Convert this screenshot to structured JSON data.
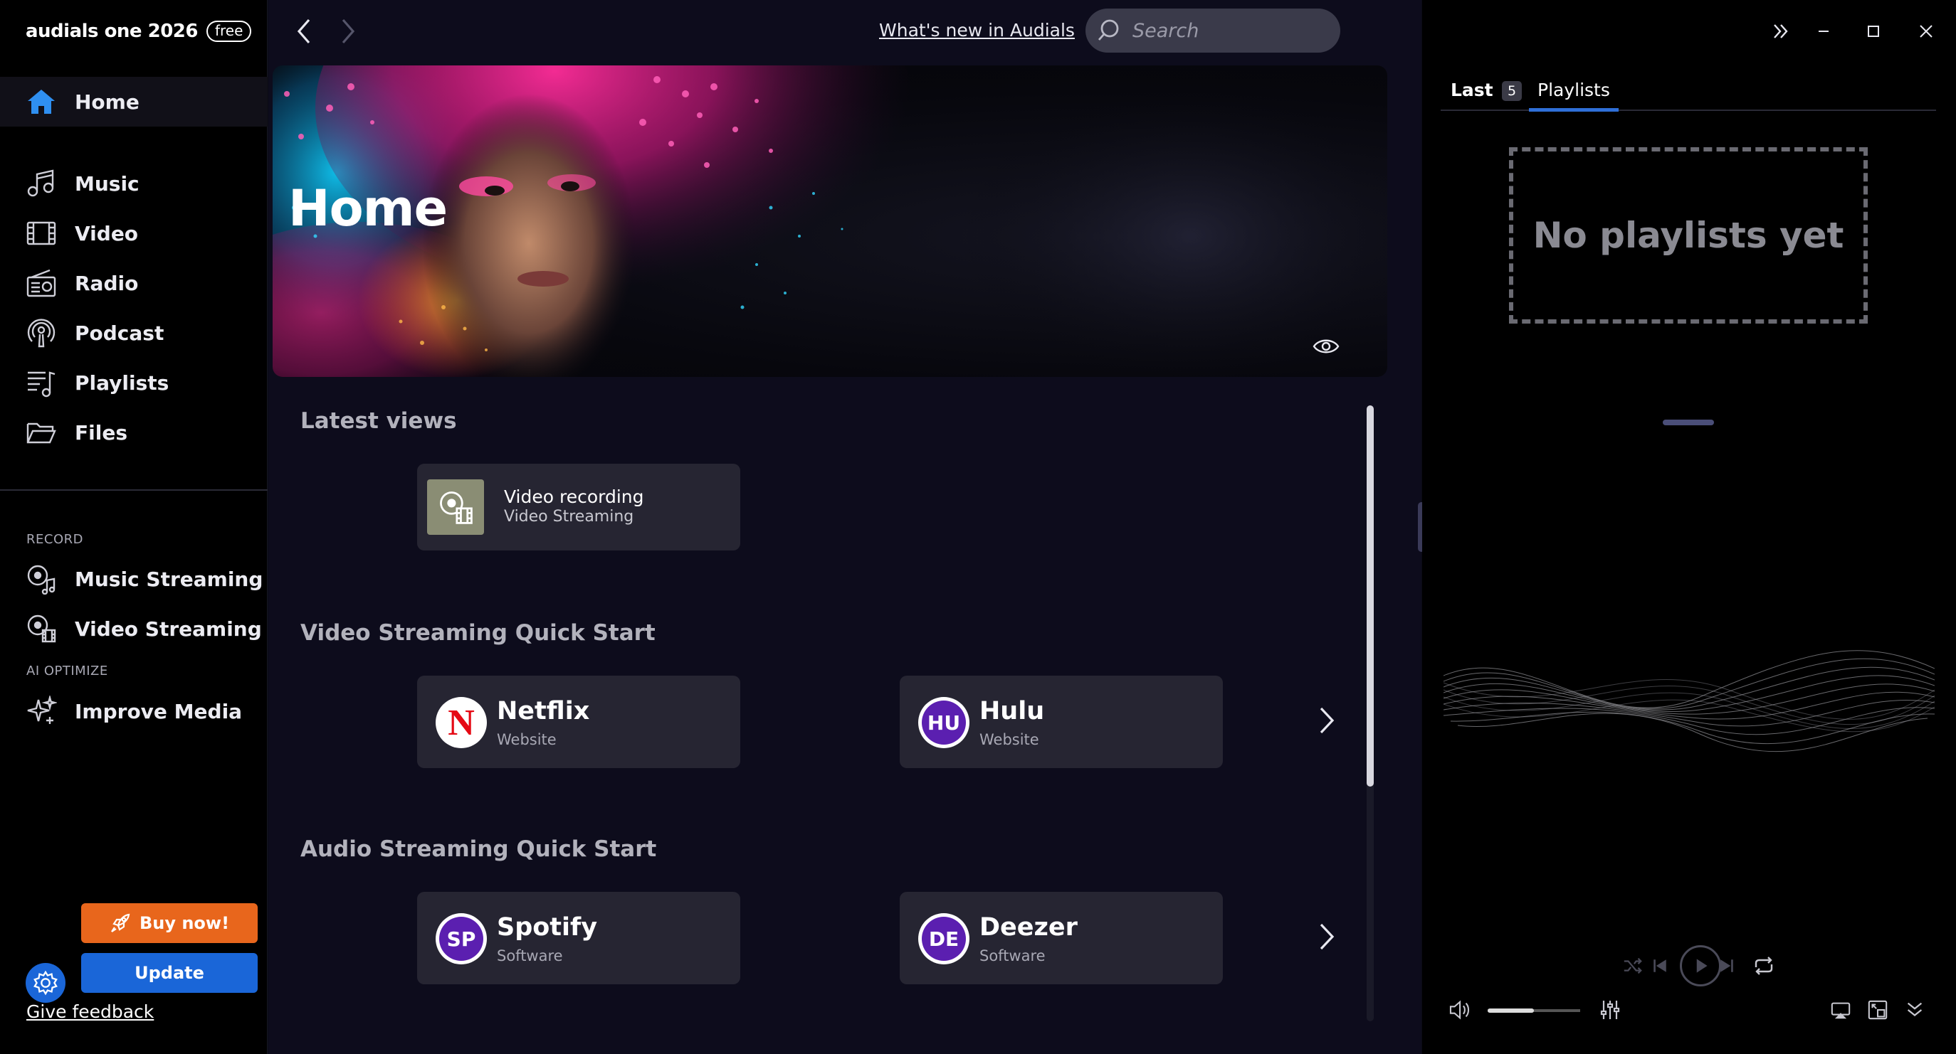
{
  "app": {
    "name": "audials one 2026",
    "badge": "free"
  },
  "sidebar": {
    "home": "Home",
    "items": [
      {
        "label": "Music",
        "icon": "music-note-icon"
      },
      {
        "label": "Video",
        "icon": "film-icon"
      },
      {
        "label": "Radio",
        "icon": "radio-icon"
      },
      {
        "label": "Podcast",
        "icon": "podcast-icon"
      },
      {
        "label": "Playlists",
        "icon": "playlist-icon"
      },
      {
        "label": "Files",
        "icon": "folder-icon"
      }
    ],
    "record_label": "RECORD",
    "record_items": [
      {
        "label": "Music Streaming",
        "icon": "music-streaming-icon"
      },
      {
        "label": "Video Streaming",
        "icon": "video-streaming-icon"
      }
    ],
    "ai_label": "AI OPTIMIZE",
    "ai_items": [
      {
        "label": "Improve Media",
        "icon": "sparkle-icon"
      }
    ],
    "buy_label": "Buy now!",
    "update_label": "Update",
    "feedback_label": "Give feedback"
  },
  "topbar": {
    "whats_new": "What's new in Audials",
    "search_placeholder": "Search"
  },
  "hero": {
    "title": "Home"
  },
  "latest_views": {
    "title": "Latest views",
    "items": [
      {
        "title": "Video recording",
        "subtitle": "Video Streaming"
      }
    ]
  },
  "video_quick_start": {
    "title": "Video Streaming Quick Start",
    "items": [
      {
        "name": "Netflix",
        "type": "Website",
        "logo": "N",
        "color": "#e50914"
      },
      {
        "name": "Hulu",
        "type": "Website",
        "logo": "HU",
        "color": "#5b1fb0"
      }
    ]
  },
  "audio_quick_start": {
    "title": "Audio Streaming Quick Start",
    "items": [
      {
        "name": "Spotify",
        "type": "Software",
        "logo": "SP",
        "color": "#5b1fb0"
      },
      {
        "name": "Deezer",
        "type": "Software",
        "logo": "DE",
        "color": "#5b1fb0"
      }
    ]
  },
  "right_panel": {
    "tab_last": "Last",
    "tab_last_count": "5",
    "tab_playlists": "Playlists",
    "empty_message": "No playlists yet",
    "volume_level": 0.5
  },
  "colors": {
    "accent": "#2f6fd8",
    "buy": "#e8661c",
    "update": "#1a66d8"
  }
}
